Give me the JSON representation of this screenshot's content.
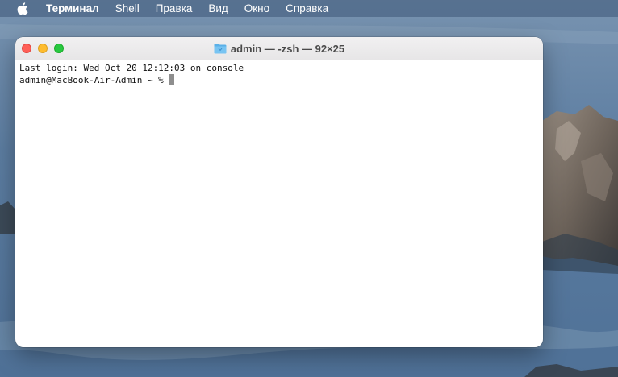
{
  "menubar": {
    "apple_icon": "apple-logo-icon",
    "app_name": "Терминал",
    "items": [
      {
        "label": "Shell"
      },
      {
        "label": "Правка"
      },
      {
        "label": "Вид"
      },
      {
        "label": "Окно"
      },
      {
        "label": "Справка"
      }
    ]
  },
  "window": {
    "title": "admin — -zsh — 92×25",
    "title_icon": "folder-icon",
    "controls": {
      "close_color": "#ff5f57",
      "minimize_color": "#febc2e",
      "zoom_color": "#28c840"
    }
  },
  "terminal": {
    "lines": [
      "Last login: Wed Oct 20 12:12:03 on console"
    ],
    "prompt": "admin@MacBook-Air-Admin ~ % "
  }
}
